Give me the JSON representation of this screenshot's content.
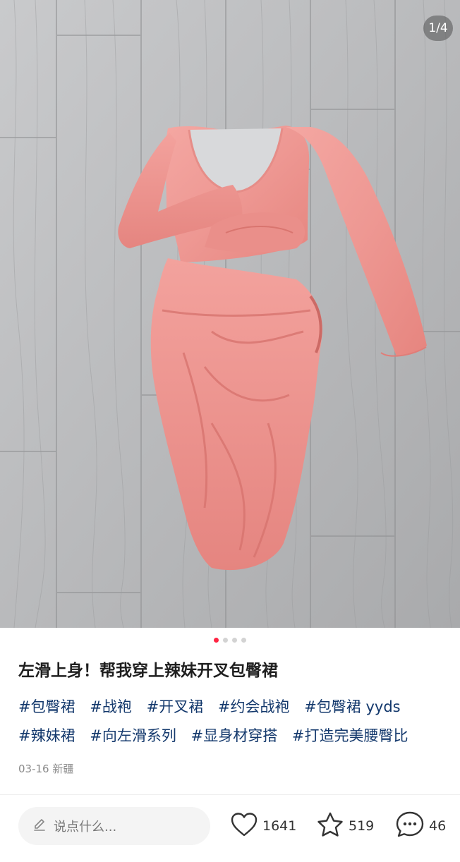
{
  "gallery": {
    "counter": "1/4",
    "dot_count": 4,
    "active_index": 0,
    "active_color": "#ff2442"
  },
  "post": {
    "title": "左滑上身！帮我穿上辣妹开叉包臀裙",
    "tags": [
      "#包臀裙",
      "#战袍",
      "#开叉裙",
      "#约会战袍",
      "#包臀裙 yyds",
      "#辣妹裙",
      "#向左滑系列",
      "#显身材穿搭",
      "#打造完美腰臀比"
    ],
    "date": "03-16",
    "location": "新疆"
  },
  "bottom_bar": {
    "comment_placeholder": "说点什么...",
    "comment_icon": "pencil-icon",
    "like_icon": "heart-icon",
    "likes": "1641",
    "collect_icon": "star-icon",
    "collects": "519",
    "comments_icon": "chat-bubble-icon",
    "comments": "46"
  }
}
